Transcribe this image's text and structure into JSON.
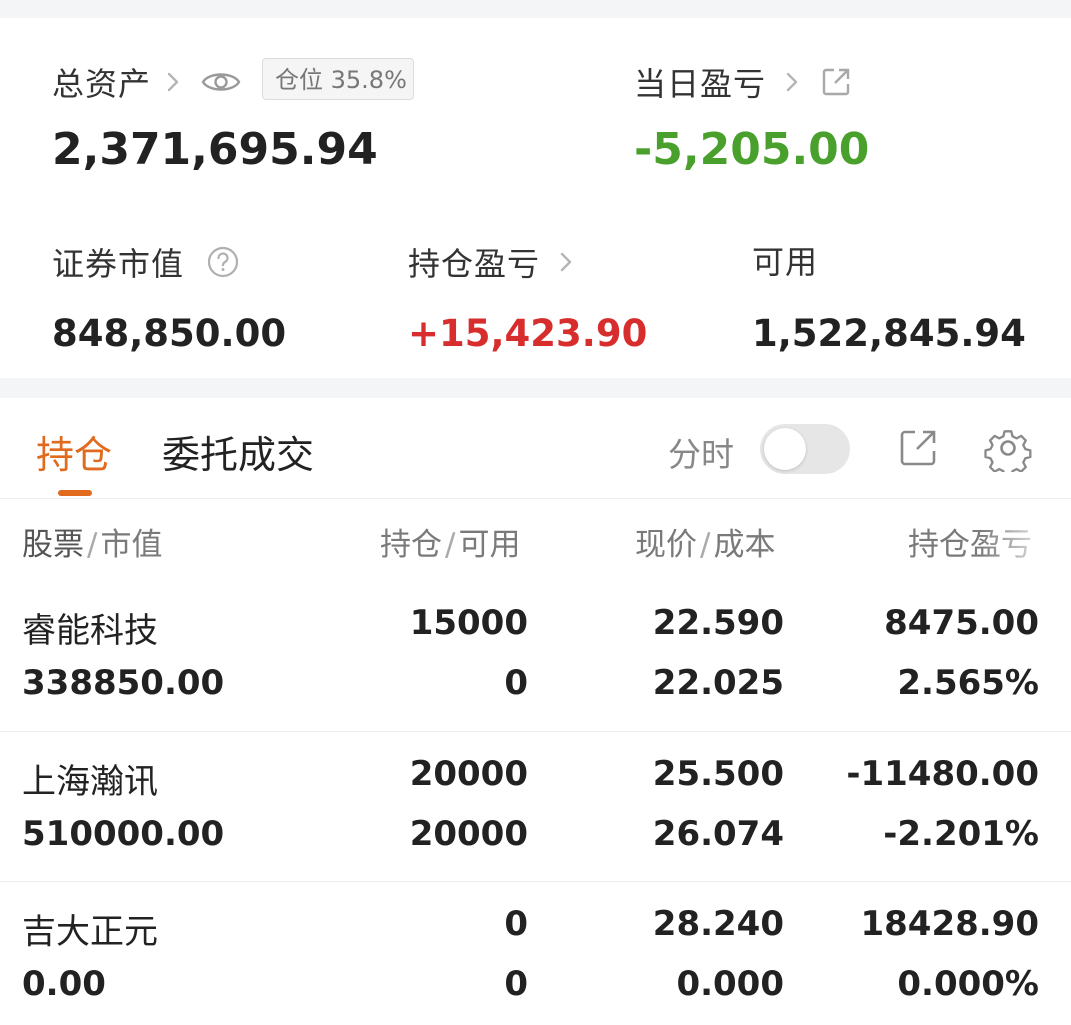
{
  "summary": {
    "total_assets_label": "总资产",
    "position_badge": "仓位 35.8%",
    "total_assets_value": "2,371,695.94",
    "daily_pnl_label": "当日盈亏",
    "daily_pnl_value": "-5,205.00",
    "market_value_label": "证券市值",
    "market_value": "848,850.00",
    "holding_pnl_label": "持仓盈亏",
    "holding_pnl_value": "+15,423.90",
    "available_label": "可用",
    "available_value": "1,522,845.94"
  },
  "tabs": {
    "holdings": "持仓",
    "orders": "委托成交",
    "timeshare_label": "分时",
    "timeshare_on": false
  },
  "table": {
    "headers": {
      "stock": "股票",
      "market_value": "市值",
      "position": "持仓",
      "available": "可用",
      "price": "现价",
      "cost": "成本",
      "pnl": "持仓盈亏"
    },
    "rows": [
      {
        "name": "睿能科技",
        "market_value": "338850.00",
        "position": "15000",
        "available": "0",
        "price": "22.590",
        "cost": "22.025",
        "pnl": "8475.00",
        "pnl_pct": "2.565%",
        "trend": "up"
      },
      {
        "name": "上海瀚讯",
        "market_value": "510000.00",
        "position": "20000",
        "available": "20000",
        "price": "25.500",
        "cost": "26.074",
        "pnl": "-11480.00",
        "pnl_pct": "-2.201%",
        "trend": "down"
      },
      {
        "name": "吉大正元",
        "market_value": "0.00",
        "position": "0",
        "available": "0",
        "price": "28.240",
        "cost": "0.000",
        "pnl": "18428.90",
        "pnl_pct": "0.000%",
        "trend": "up"
      }
    ]
  },
  "colors": {
    "up": "#d72d2d",
    "down": "#4aa02c",
    "accent": "#e06a1d"
  },
  "icons": [
    "chevron-right-icon",
    "eye-icon",
    "external-link-icon",
    "help-icon",
    "gear-icon"
  ]
}
